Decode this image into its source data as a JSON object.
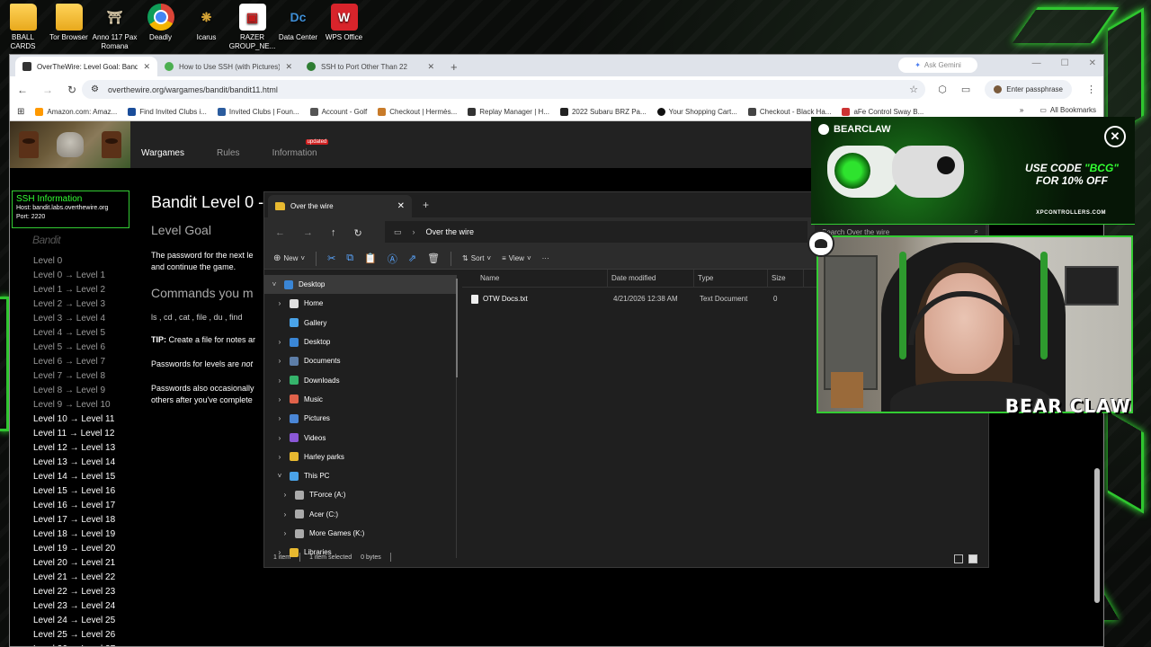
{
  "desktop": {
    "icons": [
      {
        "label": "BBALL CARDS",
        "icon": "folder-icon"
      },
      {
        "label": "Tor Browser",
        "icon": "folder-icon"
      },
      {
        "label": "Anno 117 Pax Romana",
        "icon": "anno-icon"
      },
      {
        "label": "Deadly",
        "icon": "chrome-icon"
      },
      {
        "label": "Icarus",
        "icon": "icarus-icon"
      },
      {
        "label": "RAZER GROUP_NE...",
        "icon": "razer-icon"
      },
      {
        "label": "Data Center",
        "icon": "data-center-icon"
      },
      {
        "label": "WPS Office",
        "icon": "wps-icon"
      }
    ],
    "accent_color": "#39ff39"
  },
  "browser": {
    "tabs": [
      {
        "title": "OverTheWire: Level Goal: Bandit",
        "active": true
      },
      {
        "title": "How to Use SSH (with Pictures)",
        "active": false
      },
      {
        "title": "SSH to Port Other Than 22",
        "active": false
      }
    ],
    "gemini_label": "Ask Gemini",
    "url": "overthewire.org/wargames/bandit/bandit11.html",
    "passphrase_label": "Enter passphrase",
    "bookmarks": [
      "Amazon.com: Amaz...",
      "Find Invited Clubs i...",
      "Invited Clubs | Foun...",
      "Account - Golf",
      "Checkout | Hermès...",
      "Replay Manager | H...",
      "2022 Subaru BRZ Pa...",
      "Your Shopping Cart...",
      "Checkout - Black Ha...",
      "aFe Control Sway B..."
    ],
    "all_bookmarks_label": "All Bookmarks"
  },
  "otw": {
    "nav": [
      {
        "label": "Wargames",
        "active": true
      },
      {
        "label": "Rules",
        "active": false
      },
      {
        "label": "Information",
        "active": false
      }
    ],
    "updated_badge": "updated",
    "ssh_box": {
      "heading": "SSH Information",
      "host": "Host: bandit.labs.overthewire.org",
      "port": "Port: 2220"
    },
    "sidebar_title": "Bandit",
    "levels": [
      "Level 0",
      "Level 0 → Level 1",
      "Level 1 → Level 2",
      "Level 2 → Level 3",
      "Level 3 → Level 4",
      "Level 4 → Level 5",
      "Level 5 → Level 6",
      "Level 6 → Level 7",
      "Level 7 → Level 8",
      "Level 8 → Level 9",
      "Level 9 → Level 10",
      "Level 10 → Level 11",
      "Level 11 → Level 12",
      "Level 12 → Level 13",
      "Level 13 → Level 14",
      "Level 14 → Level 15",
      "Level 15 → Level 16",
      "Level 16 → Level 17",
      "Level 17 → Level 18",
      "Level 18 → Level 19",
      "Level 19 → Level 20",
      "Level 20 → Level 21",
      "Level 21 → Level 22",
      "Level 22 → Level 23",
      "Level 23 → Level 24",
      "Level 24 → Level 25",
      "Level 25 → Level 26",
      "Level 26 → Level 27"
    ],
    "content": {
      "title": "Bandit Level 0 -",
      "level_goal": "Level Goal",
      "goal_text_1": "The password for the next le",
      "goal_text_2": "and continue the game.",
      "commands_heading": "Commands you m",
      "commands": "ls , cd , cat , file , du , find",
      "tip": "TIP:",
      "tip_text": " Create a file for notes ar",
      "passwords_1": "Passwords for levels are ",
      "passwords_1_em": "not",
      "passwords_2a": "Passwords also occasionally",
      "passwords_2b": "others after you've complete"
    }
  },
  "explorer": {
    "tab_title": "Over the wire",
    "breadcrumb": "Over the wire",
    "search_placeholder": "Search Over the wire",
    "toolbar": {
      "new": "New",
      "sort": "Sort",
      "view": "View",
      "more": "···"
    },
    "nav_items": [
      {
        "label": "Desktop",
        "icon": "desktop-icon",
        "expanded": true,
        "indent": 0,
        "selected": true
      },
      {
        "label": "Home",
        "icon": "home-icon",
        "indent": 1
      },
      {
        "label": "Gallery",
        "icon": "gallery-icon",
        "indent": 1
      },
      {
        "label": "Desktop",
        "icon": "desktop-icon",
        "indent": 1
      },
      {
        "label": "Documents",
        "icon": "documents-icon",
        "indent": 1
      },
      {
        "label": "Downloads",
        "icon": "downloads-icon",
        "indent": 1
      },
      {
        "label": "Music",
        "icon": "music-icon",
        "indent": 1
      },
      {
        "label": "Pictures",
        "icon": "pictures-icon",
        "indent": 1
      },
      {
        "label": "Videos",
        "icon": "videos-icon",
        "indent": 1
      },
      {
        "label": "Harley parks",
        "icon": "folder-icon",
        "indent": 1
      },
      {
        "label": "This PC",
        "icon": "pc-icon",
        "expanded": true,
        "indent": 1
      },
      {
        "label": "TForce (A:)",
        "icon": "drive-icon",
        "indent": 2
      },
      {
        "label": "Acer (C:)",
        "icon": "drive-icon",
        "indent": 2
      },
      {
        "label": "More Games (K:)",
        "icon": "drive-icon",
        "indent": 2
      },
      {
        "label": "Libraries",
        "icon": "folder-icon",
        "indent": 1
      }
    ],
    "columns": [
      "Name",
      "Date modified",
      "Type",
      "Size"
    ],
    "files": [
      {
        "name": "OTW Docs.txt",
        "modified": "4/21/2026 12:38 AM",
        "type": "Text Document",
        "size": "0"
      }
    ],
    "status": {
      "items": "1 item",
      "selected": "1 item selected",
      "bytes": "0 bytes"
    }
  },
  "overlay": {
    "ad_brand": "BEARCLAW",
    "ad_line1a": "USE CODE ",
    "ad_code": "\"BCG\"",
    "ad_line2": "FOR 10% OFF",
    "ad_url": "XPCONTROLLERS.COM",
    "cam_brand": "BEAR CLAW"
  }
}
